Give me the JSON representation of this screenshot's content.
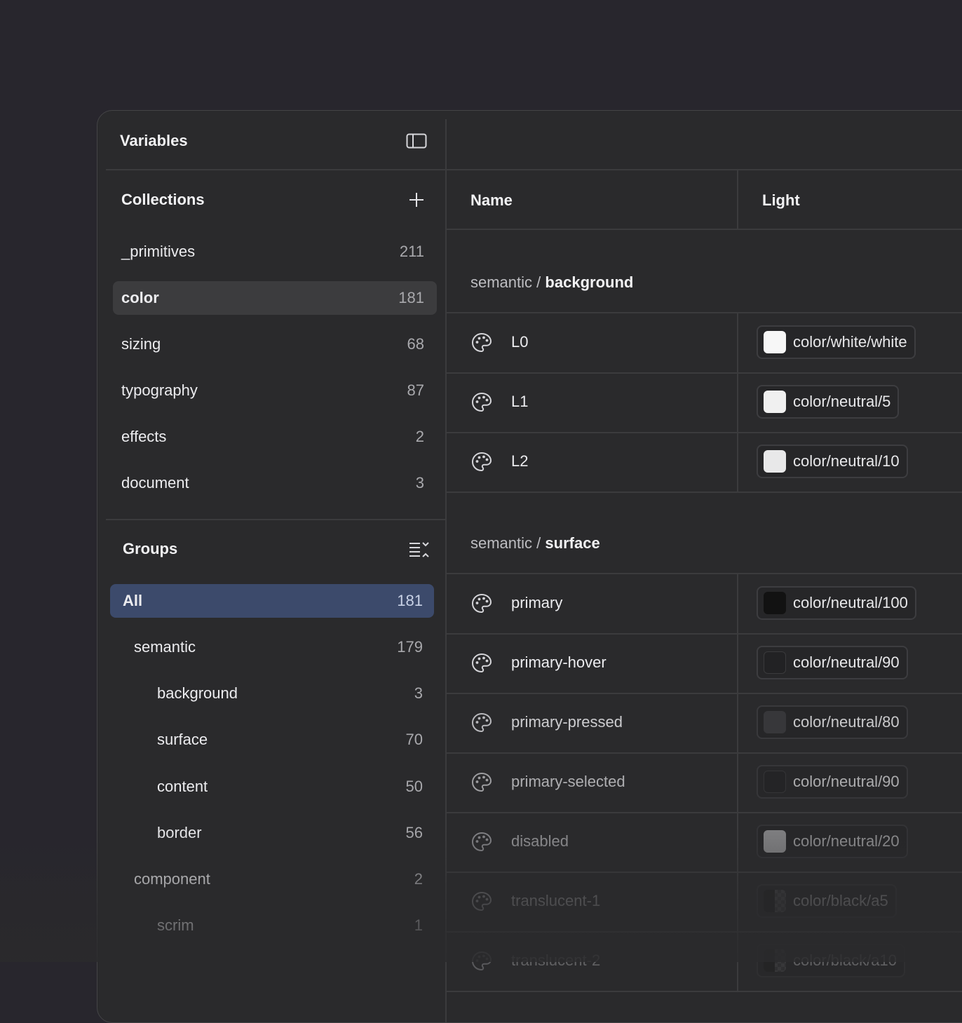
{
  "sidebar": {
    "title": "Variables",
    "collections": {
      "title": "Collections",
      "items": [
        {
          "label": "_primitives",
          "count": "211"
        },
        {
          "label": "color",
          "count": "181"
        },
        {
          "label": "sizing",
          "count": "68"
        },
        {
          "label": "typography",
          "count": "87"
        },
        {
          "label": "effects",
          "count": "2"
        },
        {
          "label": "document",
          "count": "3"
        }
      ]
    },
    "groups": {
      "title": "Groups",
      "items": [
        {
          "label": "All",
          "count": "181"
        },
        {
          "label": "semantic",
          "count": "179"
        },
        {
          "label": "background",
          "count": "3"
        },
        {
          "label": "surface",
          "count": "70"
        },
        {
          "label": "content",
          "count": "50"
        },
        {
          "label": "border",
          "count": "56"
        },
        {
          "label": "component",
          "count": "2"
        },
        {
          "label": "scrim",
          "count": "1"
        }
      ]
    }
  },
  "table": {
    "columns": {
      "name": "Name",
      "light": "Light"
    },
    "sections": [
      {
        "prefix": "semantic",
        "separator": "/",
        "group": "background",
        "rows": [
          {
            "name": "L0",
            "value": "color/white/white",
            "swatch": "#f7f7f7"
          },
          {
            "name": "L1",
            "value": "color/neutral/5",
            "swatch": "#f0f0f0"
          },
          {
            "name": "L2",
            "value": "color/neutral/10",
            "swatch": "#e8e8e9"
          }
        ]
      },
      {
        "prefix": "semantic",
        "separator": "/",
        "group": "surface",
        "rows": [
          {
            "name": "primary",
            "value": "color/neutral/100",
            "swatch": "#121212"
          },
          {
            "name": "primary-hover",
            "value": "color/neutral/90",
            "swatch": "#222224"
          },
          {
            "name": "primary-pressed",
            "value": "color/neutral/80",
            "swatch": "#3a3a3d"
          },
          {
            "name": "primary-selected",
            "value": "color/neutral/90",
            "swatch": "#222224"
          },
          {
            "name": "disabled",
            "value": "color/neutral/20",
            "swatch": "#cfcfd1"
          },
          {
            "name": "translucent-1",
            "value": "color/black/a5",
            "swatch": "checker"
          },
          {
            "name": "translucent-2",
            "value": "color/black/a10",
            "swatch": "checker"
          }
        ]
      }
    ]
  },
  "colors": {
    "background": "#28262d",
    "panel": "#2a2a2c",
    "selected_collection": "#3c3c3e",
    "selected_group": "#3c4a6b"
  }
}
